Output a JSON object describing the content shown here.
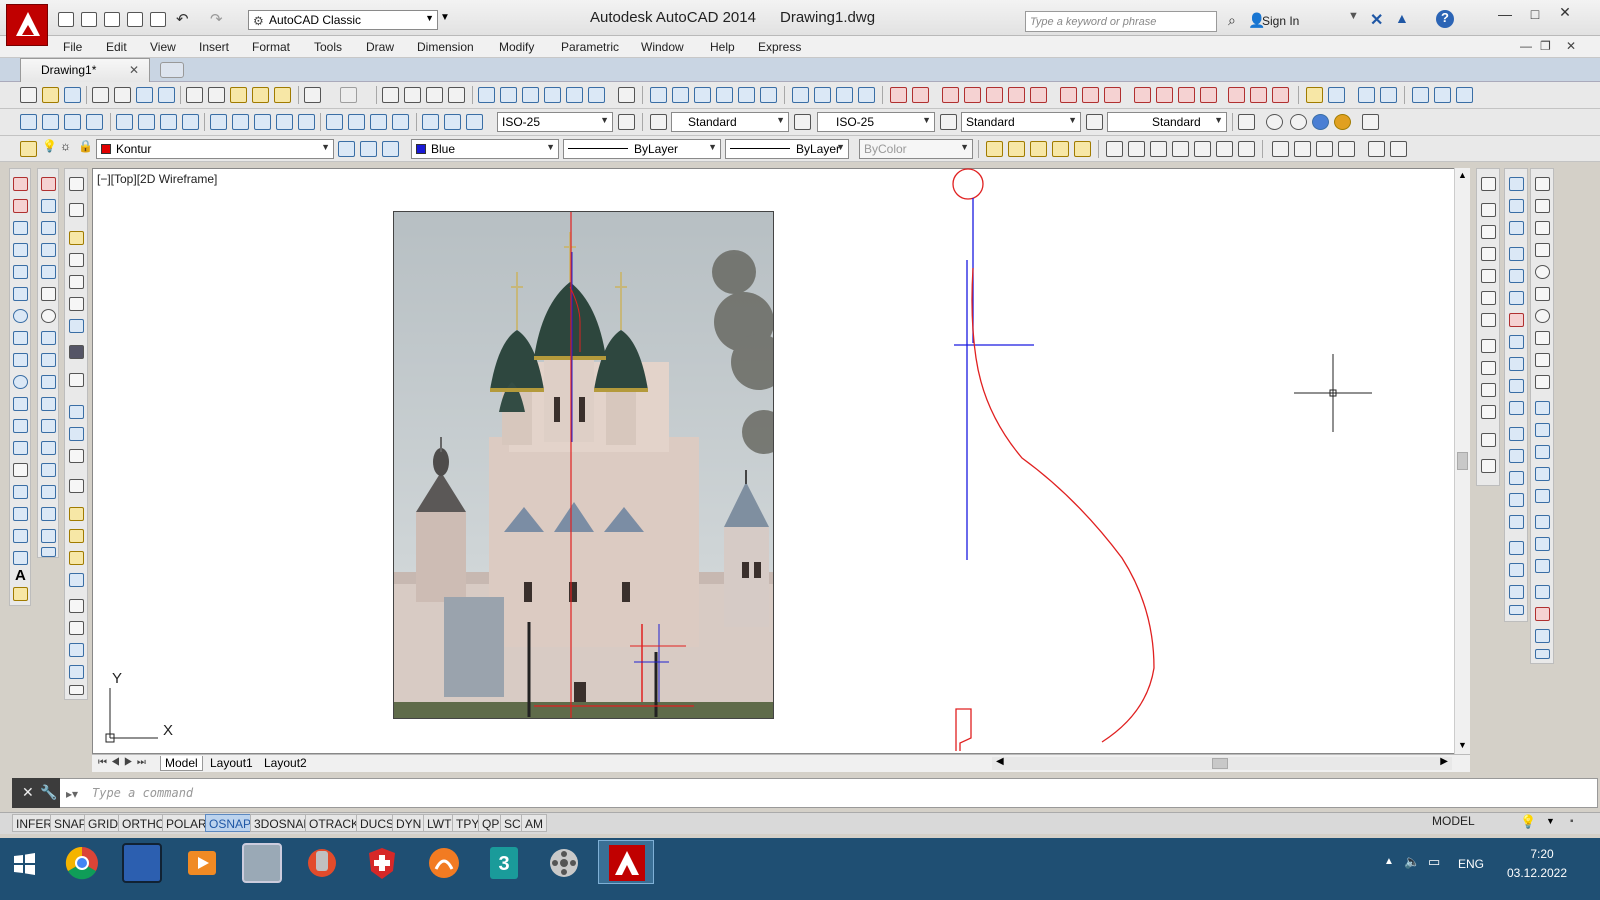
{
  "window": {
    "app_title": "Autodesk AutoCAD 2014",
    "file_name": "Drawing1.dwg",
    "workspace": "AutoCAD Classic",
    "search_placeholder": "Type a keyword or phrase",
    "sign_in": "Sign In"
  },
  "menu": [
    "File",
    "Edit",
    "View",
    "Insert",
    "Format",
    "Tools",
    "Draw",
    "Dimension",
    "Modify",
    "Parametric",
    "Window",
    "Help",
    "Express"
  ],
  "doc_tab": "Drawing1*",
  "styles_toolbar": {
    "dim_style": "ISO-25",
    "text_style": "Standard",
    "multileader_style": "ISO-25",
    "table_style": "Standard",
    "visual_style": "Standard"
  },
  "layers_toolbar": {
    "layer": "Kontur",
    "layer_color": "#e00000",
    "color": "Blue",
    "color_value": "#1a1ad6",
    "linetype": "ByLayer",
    "lineweight": "ByLayer",
    "plot_style": "ByColor"
  },
  "viewport_label": "[−][Top][2D Wireframe]",
  "ucs": {
    "x": "X",
    "y": "Y"
  },
  "layout_tabs": [
    "Model",
    "Layout1",
    "Layout2"
  ],
  "command_placeholder": "Type a command",
  "status_buttons": [
    "INFER",
    "SNAP",
    "GRID",
    "ORTHO",
    "POLAR",
    "OSNAP",
    "3DOSNAP",
    "OTRACK",
    "DUCS",
    "DYN",
    "LWT",
    "TPY",
    "QP",
    "SC",
    "AM"
  ],
  "status_active": [
    "OSNAP"
  ],
  "model_label": "MODEL",
  "taskbar": {
    "apps": [
      "windows-start",
      "chrome",
      "save-manager",
      "media-player",
      "calculator",
      "ccleaner",
      "antivirus",
      "sketchup-like",
      "3ds-max",
      "film-reel",
      "autocad"
    ],
    "language": "ENG",
    "time": "7:20",
    "date": "03.12.2022"
  },
  "colors": {
    "drawing_red": "#e02020",
    "drawing_blue": "#1a1ae0",
    "taskbar_bg": "#1f4f73",
    "osnap_active": "#1f57a5"
  }
}
